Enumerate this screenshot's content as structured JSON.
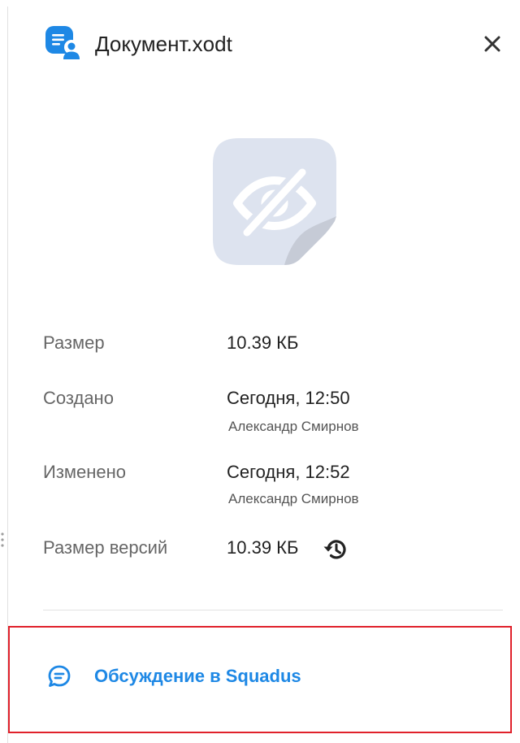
{
  "header": {
    "title": "Документ.xodt",
    "doc_icon": "document-user-icon",
    "close_icon": "close-icon"
  },
  "preview": {
    "icon": "preview-unavailable-icon"
  },
  "details": {
    "size_label": "Размер",
    "size_value": "10.39 КБ",
    "created_label": "Создано",
    "created_value": "Сегодня, 12:50",
    "created_by": "Александр Смирнов",
    "modified_label": "Изменено",
    "modified_value": "Сегодня, 12:52",
    "modified_by": "Александр Смирнов",
    "versions_size_label": "Размер версий",
    "versions_size_value": "10.39 КБ",
    "history_icon": "history-icon"
  },
  "discussion": {
    "label": "Обсуждение в Squadus",
    "icon": "chat-icon"
  },
  "colors": {
    "accent": "#1e88e5",
    "highlight_border": "#e0212b",
    "preview_bg": "#dde3ef",
    "preview_fold": "#c6cbd6"
  }
}
